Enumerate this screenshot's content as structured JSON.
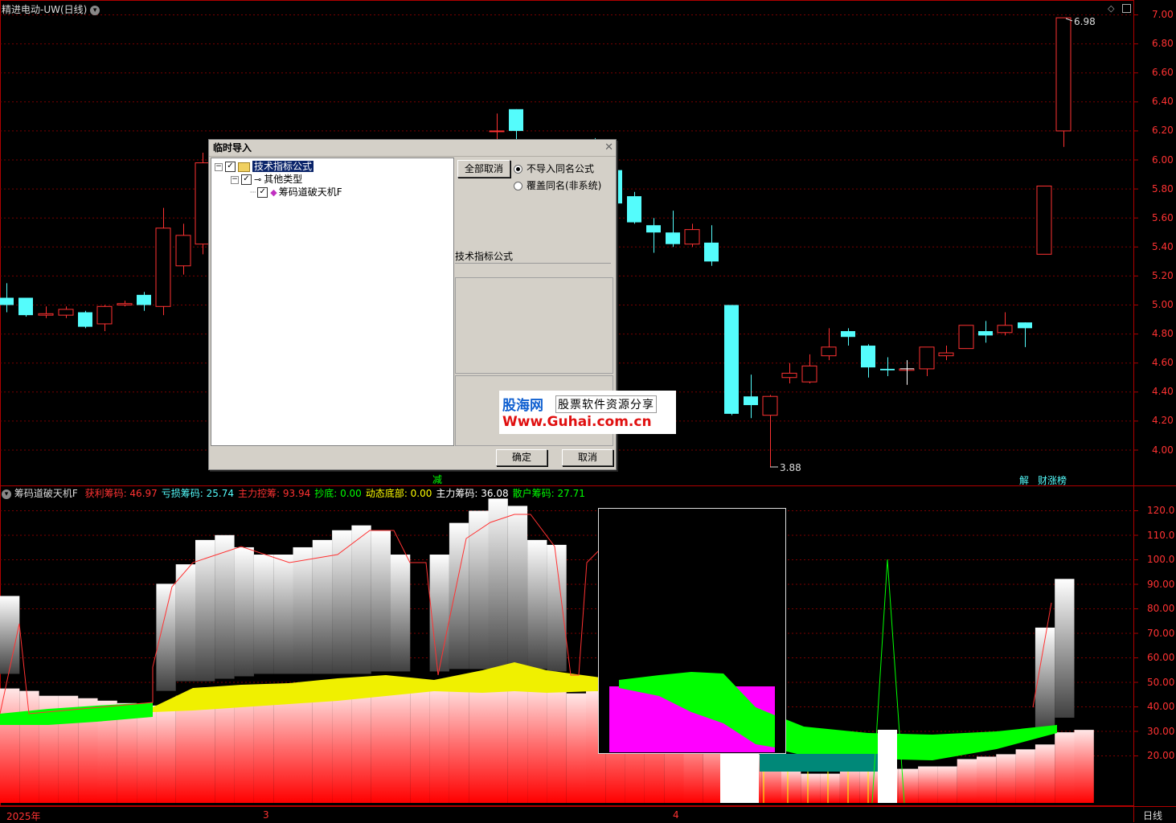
{
  "window": {
    "title": "精进电动-UW(日线)",
    "title_dropdown_icon": "chevron-down-icon"
  },
  "main_chart": {
    "price_axis": [
      "7.00",
      "6.80",
      "6.60",
      "6.40",
      "6.20",
      "6.00",
      "5.80",
      "5.60",
      "5.40",
      "5.20",
      "5.00",
      "4.80",
      "4.60",
      "4.40",
      "4.20",
      "4.00"
    ],
    "high_label": "6.98",
    "low_label": "3.88",
    "badge_reduce": "减",
    "badge_unlock": "解",
    "badge_list": "财涨榜",
    "colors": {
      "up": "#ff3232",
      "down": "#54fcfc",
      "grid": "#7a0000"
    }
  },
  "indicator": {
    "name": "筹码道破天机F",
    "legend": [
      {
        "label": "获利筹码:",
        "value": "46.97",
        "color": "#ff3232"
      },
      {
        "label": "亏损筹码:",
        "value": "25.74",
        "color": "#54fcfc"
      },
      {
        "label": "主力控筹:",
        "value": "93.94",
        "color": "#ff3232"
      },
      {
        "label": "抄底:",
        "value": "0.00",
        "color": "#00ff00"
      },
      {
        "label": "动态底部:",
        "value": "0.00",
        "color": "#ffff00"
      },
      {
        "label": "主力筹码:",
        "value": "36.08",
        "color": "#ffffff"
      },
      {
        "label": "散户筹码:",
        "value": "27.71",
        "color": "#00ff00"
      }
    ],
    "axis": [
      "120.0",
      "110.0",
      "100.0",
      "90.00",
      "80.00",
      "70.00",
      "60.00",
      "50.00",
      "40.00",
      "30.00",
      "20.00"
    ]
  },
  "time_axis": {
    "labels": [
      "2025年",
      "3",
      "4"
    ],
    "period": "日线"
  },
  "dialog": {
    "title": "临时导入",
    "tree": {
      "root": "技术指标公式",
      "child": "其他类型",
      "leaf": "筹码道破天机F"
    },
    "deselect_all": "全部取消",
    "radio_no_import": "不导入同名公式",
    "radio_overwrite": "覆盖同名(非系统)",
    "section_label": "技术指标公式",
    "ok": "确定",
    "cancel": "取消"
  },
  "watermark": {
    "brand": "股海网",
    "tagline": "股票软件资源分享",
    "url": "Www.Guhai.com.cn"
  }
}
